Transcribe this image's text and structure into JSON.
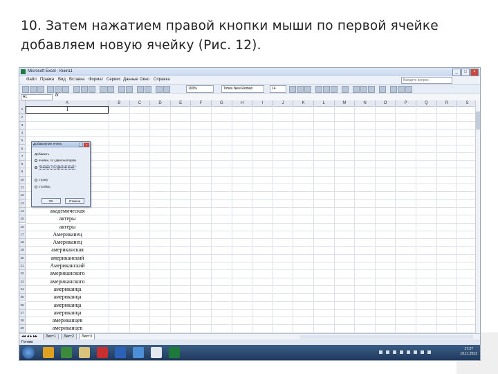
{
  "slide": {
    "title_line1": "10. Затем нажатием правой кнопки мыши по первой ячейке",
    "title_line2": "добавляем новую ячейку (Рис. 12)."
  },
  "window": {
    "title": "Microsoft Excel - Книга1",
    "controls": [
      "_",
      "□",
      "×"
    ]
  },
  "menu": {
    "items": [
      "Файл",
      "Правка",
      "Вид",
      "Вставка",
      "Формат",
      "Сервис",
      "Данные",
      "Окно",
      "Справка"
    ],
    "help_placeholder": "Введите вопрос"
  },
  "toolbar": {
    "zoom": "100%",
    "font": "Times New Roman",
    "size": "14"
  },
  "formula_bar": {
    "name_box": "A1",
    "fx": "fx"
  },
  "grid": {
    "columns": [
      "A",
      "B",
      "C",
      "D",
      "E",
      "F",
      "G",
      "H",
      "I",
      "J",
      "K",
      "L",
      "M",
      "N",
      "O",
      "P",
      "Q",
      "R",
      "S"
    ],
    "rows": [
      "1",
      "2",
      "3",
      "4",
      "5",
      "6",
      "7",
      "8",
      "9",
      "10",
      "11",
      "12",
      "13",
      "14",
      "15",
      "16",
      "17",
      "18",
      "19",
      "20",
      "21",
      "22",
      "23",
      "24",
      "25",
      "26",
      "27",
      "28",
      "29"
    ],
    "column_a": [
      "1",
      "",
      "",
      "",
      "",
      "",
      "",
      "",
      "а",
      "а",
      "а",
      "а",
      "а",
      "академическая",
      "актеры",
      "актеры",
      "Американец",
      "Американец",
      "американская",
      "американский",
      "Американский",
      "американского",
      "американского",
      "американца",
      "американца",
      "американца",
      "американца",
      "американцев",
      "американцев"
    ]
  },
  "dialog": {
    "title": "Добавление ячеек",
    "help": "?",
    "close": "×",
    "group_label": "Добавить",
    "options": [
      {
        "label": "ячейки, со сдвигом вправо",
        "selected": false
      },
      {
        "label": "ячейки, со сдвигом вниз",
        "selected": true
      },
      {
        "label": "строку",
        "selected": false
      },
      {
        "label": "столбец",
        "selected": false
      }
    ],
    "ok": "OK",
    "cancel": "Отмена"
  },
  "sheets": {
    "tabs": [
      "Лист1",
      "Лист2",
      "Лист3"
    ],
    "active": 2
  },
  "status": "Готово",
  "taskbar": {
    "time": "17:27",
    "date": "19.11.2013"
  }
}
